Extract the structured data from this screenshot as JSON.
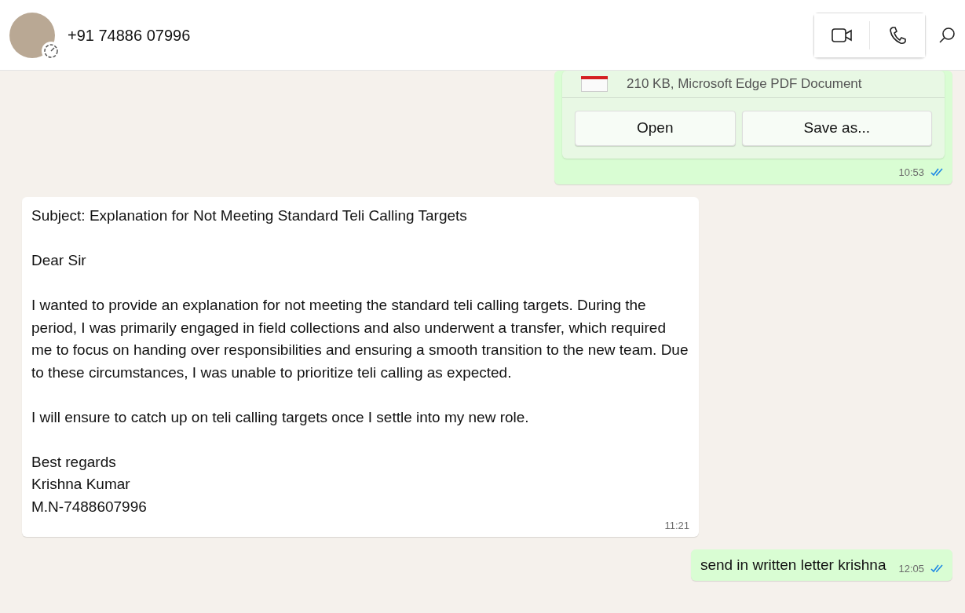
{
  "header": {
    "contact": "+91 74886 07996",
    "status_ring": true
  },
  "messages": [
    {
      "kind": "file",
      "outgoing": true,
      "details": "210 KB, Microsoft Edge PDF Document",
      "buttons": [
        "Open",
        "Save as..."
      ],
      "time": "10:53",
      "read": true
    },
    {
      "kind": "text",
      "outgoing": false,
      "text": "Subject: Explanation for Not Meeting Standard Teli Calling Targets\n\nDear Sir\n\nI wanted to provide an explanation for not meeting the standard teli calling targets. During the period, I was primarily engaged in field collections and also underwent a transfer, which required me to focus on handing over responsibilities and ensuring a smooth transition to the new team. Due to these circumstances, I was unable to prioritize teli calling as expected.\n\nI will ensure to catch up on teli calling targets once I settle into my new role.\n\nBest regards\nKrishna Kumar\nM.N-7488607996",
      "time": "11:21",
      "read": false
    },
    {
      "kind": "text",
      "outgoing": true,
      "text": "send in written letter krishna",
      "time": "12:05",
      "read": true
    }
  ]
}
